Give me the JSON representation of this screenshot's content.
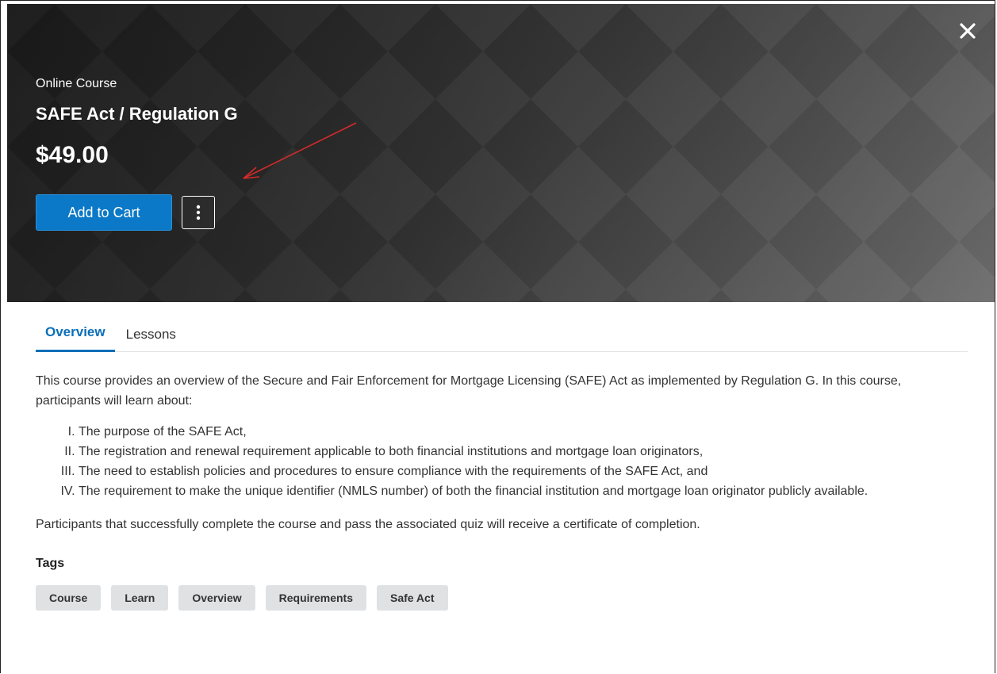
{
  "hero": {
    "course_type": "Online Course",
    "title": "SAFE Act / Regulation G",
    "price": "$49.00",
    "add_to_cart_label": "Add to Cart",
    "close_icon": "close-icon",
    "more_icon": "vertical-ellipsis-icon"
  },
  "tabs": [
    {
      "label": "Overview",
      "active": true
    },
    {
      "label": "Lessons",
      "active": false
    }
  ],
  "overview": {
    "intro": "This course provides an overview of the Secure and Fair Enforcement for Mortgage Licensing (SAFE) Act as implemented by Regulation G. In this course, participants will learn about:",
    "topics": [
      "The purpose of the SAFE Act,",
      "The registration and renewal requirement applicable to both financial institutions and mortgage loan originators,",
      "The need to establish policies and procedures to ensure compliance with the requirements of the SAFE Act, and",
      "The requirement to make the unique identifier (NMLS number) of both the financial institution and mortgage loan originator publicly available."
    ],
    "completion_note": "Participants that successfully complete the course and pass the associated quiz will receive a certificate of completion."
  },
  "tags": {
    "title": "Tags",
    "items": [
      "Course",
      "Learn",
      "Overview",
      "Requirements",
      "Safe Act"
    ]
  },
  "colors": {
    "primary": "#0b79c7",
    "active_tab": "#0b6fb8",
    "tag_bg": "#dfe1e3",
    "annotation_arrow": "#d42a2a"
  }
}
